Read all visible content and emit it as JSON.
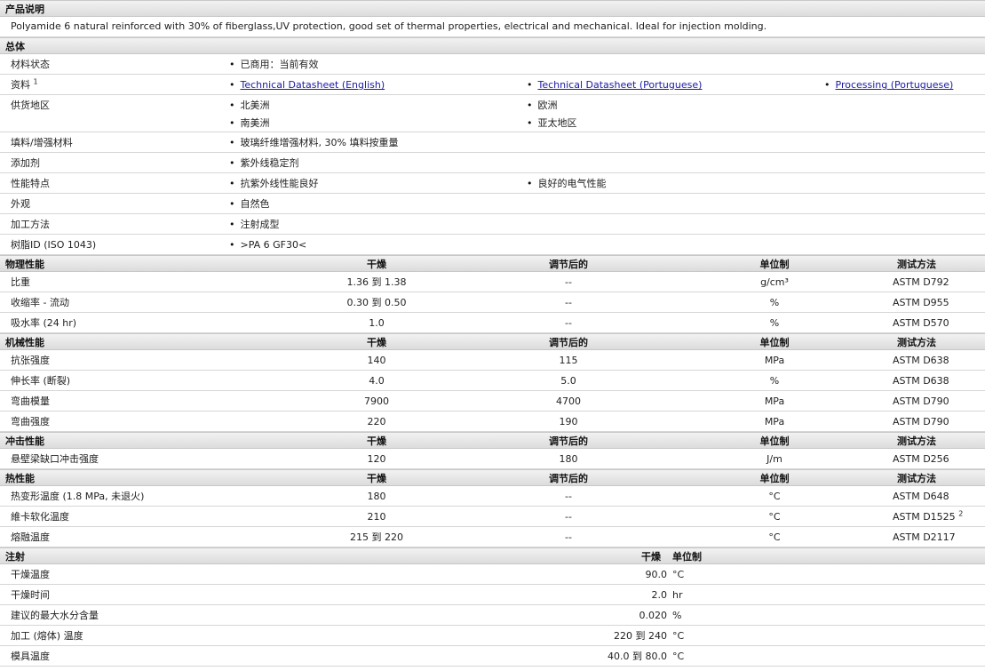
{
  "product": {
    "heading": "产品说明",
    "description": "Polyamide 6 natural reinforced with 30% of fiberglass,UV protection, good set of thermal properties, electrical and mechanical. Ideal for injection molding."
  },
  "general": {
    "heading": "总体",
    "status_label": "材料状态",
    "status_value": "已商用：当前有效",
    "resources_label": "资料",
    "resources_sup": "1",
    "resources": [
      "Technical Datasheet (English)",
      "Technical Datasheet (Portuguese)",
      "Processing (Portuguese)"
    ],
    "regions_label": "供货地区",
    "regions": [
      "北美洲",
      "欧洲",
      "南美洲",
      "亚太地区"
    ],
    "filler_label": "填料/增强材料",
    "filler_value": "玻璃纤维增强材料, 30% 填料按重量",
    "additive_label": "添加剂",
    "additive_value": "紫外线稳定剂",
    "features_label": "性能特点",
    "features": [
      "抗紫外线性能良好",
      "良好的电气性能"
    ],
    "appearance_label": "外观",
    "appearance_value": "自然色",
    "processing_label": "加工方法",
    "processing_value": "注射成型",
    "resin_label": "树脂ID (ISO 1043)",
    "resin_value": ">PA 6 GF30<"
  },
  "columns": {
    "dry": "干燥",
    "conditioned": "调节后的",
    "unit": "单位制",
    "method": "测试方法"
  },
  "physical": {
    "heading": "物理性能",
    "rows": [
      {
        "name": "比重",
        "dry": "1.36 到  1.38",
        "cond": "--",
        "unit": "g/cm³",
        "std": "ASTM D792"
      },
      {
        "name": "收缩率 - 流动",
        "dry": "0.30 到  0.50",
        "cond": "--",
        "unit": "%",
        "std": "ASTM D955"
      },
      {
        "name": "吸水率 (24 hr)",
        "dry": "1.0",
        "cond": "--",
        "unit": "%",
        "std": "ASTM D570"
      }
    ]
  },
  "mechanical": {
    "heading": "机械性能",
    "rows": [
      {
        "name": "抗张强度",
        "dry": "140",
        "cond": "115",
        "unit": "MPa",
        "std": "ASTM D638"
      },
      {
        "name": "伸长率 (断裂)",
        "dry": "4.0",
        "cond": "5.0",
        "unit": "%",
        "std": "ASTM D638"
      },
      {
        "name": "弯曲模量",
        "dry": "7900",
        "cond": "4700",
        "unit": "MPa",
        "std": "ASTM D790"
      },
      {
        "name": "弯曲强度",
        "dry": "220",
        "cond": "190",
        "unit": "MPa",
        "std": "ASTM D790"
      }
    ]
  },
  "impact": {
    "heading": "冲击性能",
    "rows": [
      {
        "name": "悬壁梁缺口冲击强度",
        "dry": "120",
        "cond": "180",
        "unit": "J/m",
        "std": "ASTM D256"
      }
    ]
  },
  "thermal": {
    "heading": "热性能",
    "rows": [
      {
        "name": "热变形温度 (1.8 MPa, 未退火)",
        "dry": "180",
        "cond": "--",
        "unit": "°C",
        "std": "ASTM D648"
      },
      {
        "name": "維卡软化温度",
        "dry": "210",
        "cond": "--",
        "unit": "°C",
        "std": "ASTM D1525",
        "sup": "2"
      },
      {
        "name": "熔融温度",
        "dry": "215 到  220",
        "cond": "--",
        "unit": "°C",
        "std": "ASTM D2117"
      }
    ]
  },
  "injection": {
    "heading": "注射",
    "col_dry": "干燥",
    "col_unit": "单位制",
    "rows": [
      {
        "name": "干燥温度",
        "value": "90.0",
        "unit": "°C"
      },
      {
        "name": "干燥时间",
        "value": "2.0",
        "unit": "hr"
      },
      {
        "name": "建议的最大水分含量",
        "value": "0.020",
        "unit": "%"
      },
      {
        "name": "加工 (熔体) 温度",
        "value": "220 到  240",
        "unit": "°C"
      },
      {
        "name": "模具温度",
        "value": "40.0 到  80.0",
        "unit": "°C"
      }
    ]
  }
}
